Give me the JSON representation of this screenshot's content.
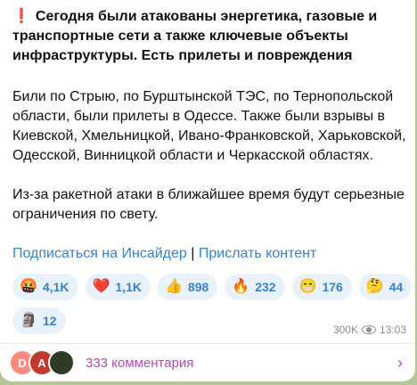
{
  "post": {
    "warning_icon": "❗",
    "title": "Сегодня были атакованы энергетика, газовые и транспортные сети а также ключевые объекты инфраструктуры. Есть прилеты и повреждения",
    "paragraph1": "Били по Стрыю, по Бурштынской ТЭС, по Тернопольской области, были прилеты в Одессе. Также были взрывы в Киевской, Хмельницкой, Ивано-Франковской, Харьковской, Одесской,  Винницкой области и Черкасской областях.",
    "paragraph2": "Из-за ракетной атаки в ближайшее время будут серьезные ограничения по свету.",
    "link_subscribe": "Подписаться на Инсайдер",
    "link_separator": "|",
    "link_send": "Прислать контент"
  },
  "reactions": [
    {
      "emoji": "🤬",
      "count": "4,1K"
    },
    {
      "emoji": "❤️",
      "count": "1,1K"
    },
    {
      "emoji": "👍",
      "count": "898"
    },
    {
      "emoji": "🔥",
      "count": "232"
    },
    {
      "emoji": "😁",
      "count": "176"
    },
    {
      "emoji": "🤔",
      "count": "44"
    },
    {
      "emoji": "🗿",
      "count": "12"
    }
  ],
  "meta": {
    "views": "300K",
    "time": "13:03"
  },
  "comments": {
    "avatars": [
      "D",
      "A",
      ""
    ],
    "label": "333 комментария"
  },
  "colors": {
    "background": "#b7c59a",
    "link": "#3a82c8",
    "comments": "#b64bb0",
    "warning": "#e53935"
  }
}
